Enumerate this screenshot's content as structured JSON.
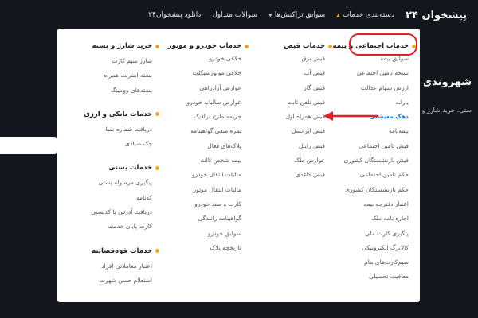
{
  "brand": "پیشخوان ۲۴",
  "nav": [
    {
      "label": "دسته‌بندی خدمات"
    },
    {
      "label": "سوابق تراکنش‌ها"
    },
    {
      "label": "سوالات متداول"
    },
    {
      "label": "دانلود پیشخوان۲۴"
    }
  ],
  "hero": {
    "title": "شهروندی",
    "subtitle": "ستی، خرید شارژ و اینترنت"
  },
  "colors": {
    "accent": "#f5a623",
    "highlight": "#e31e24",
    "active_link": "#1e73d8"
  },
  "columns": [
    {
      "groups": [
        {
          "title": "خدمات اجتماعی و بیمه",
          "items": [
            "سوابق بیمه",
            "نسخه تامین اجتماعی",
            "ارزش سهام عدالت",
            "یارانه",
            "دهک معیشتی",
            "بیمه‌نامه",
            "فیش تامین اجتماعی",
            "فیش بازنشستگان کشوری",
            "حکم تامین اجتماعی",
            "حکم بازنشستگان کشوری",
            "اعتبار دفترچه بیمه",
            "اجاره نامه ملک",
            "پیگیری کارت ملی",
            "کالابرگ الکترونیکی",
            "سیم‌کارت‌های بنام",
            "معافیت تحصیلی"
          ],
          "active_index": 4
        }
      ]
    },
    {
      "groups": [
        {
          "title": "خدمات قبض",
          "items": [
            "قبض برق",
            "قبض آب",
            "قبض گاز",
            "قبض تلفن ثابت",
            "قبض همراه اول",
            "قبض ایرانسل",
            "قبض رایتل",
            "عوارض ملک",
            "قبض کاغذی"
          ]
        }
      ]
    },
    {
      "groups": [
        {
          "title": "خدمات خودرو و موتور",
          "items": [
            "خلافی خودرو",
            "خلافی موتورسیکلت",
            "عوارض آزادراهی",
            "عوارض سالیانه خودرو",
            "جریمه طرح ترافیک",
            "نمره منفی گواهینامه",
            "پلاک‌های فعال",
            "بیمه شخص ثالث",
            "مالیات انتقال خودرو",
            "مالیات انتقال موتور",
            "کارت و سند خودرو",
            "گواهینامه رانندگی",
            "سوابق خودرو",
            "تاریخچه پلاک"
          ]
        }
      ]
    },
    {
      "groups": [
        {
          "title": "خرید شارژ و بسته",
          "items": [
            "شارژ سیم کارت",
            "بسته اینترنت همراه",
            "بسته‌های رومینگ"
          ]
        },
        {
          "title": "خدمات بانکی و ارزی",
          "items": [
            "دریافت شماره شبا",
            "چک صیادی"
          ]
        },
        {
          "title": "خدمات پستی",
          "items": [
            "پیگیری مرسوله پستی",
            "کدنامه",
            "دریافت آدرس با کدپستی",
            "کارت پایان خدمت"
          ]
        },
        {
          "title": "خدمات قوه‌قضائیه",
          "items": [
            "اعتبار معاملاتی افراد",
            "استعلام حسن شهرت"
          ]
        }
      ]
    }
  ]
}
